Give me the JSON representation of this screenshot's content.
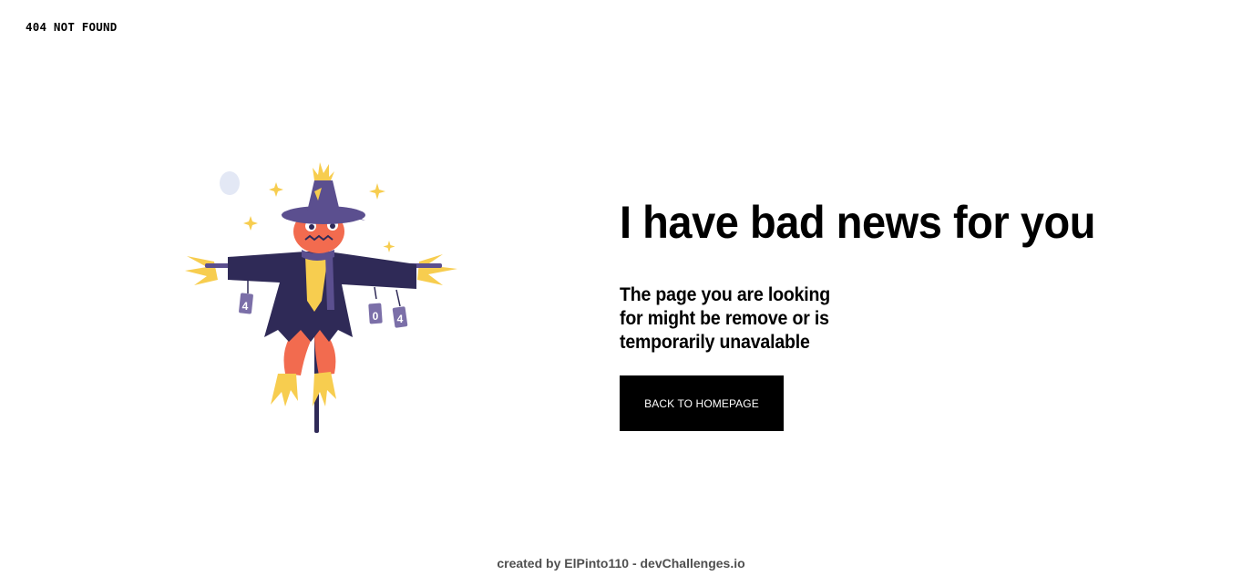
{
  "header": {
    "title": "404 NOT FOUND"
  },
  "illustration": {
    "name": "scarecrow",
    "sign_digits": [
      "4",
      "0",
      "4"
    ]
  },
  "main": {
    "headline": "I have bad news for you",
    "message": "The page you are looking for might be remove or is temporarily unavalable",
    "button_label": "BACK TO HOMEPAGE"
  },
  "footer": {
    "credit": "created by ElPinto110 - devChallenges.io"
  },
  "colors": {
    "text": "#000000",
    "button_bg": "#000000",
    "button_text": "#ffffff",
    "footer_text": "#4f4f4f",
    "hat": "#5b4f8f",
    "coat": "#2f2a57",
    "body": "#f26b4f",
    "straw": "#f7cd4f"
  }
}
